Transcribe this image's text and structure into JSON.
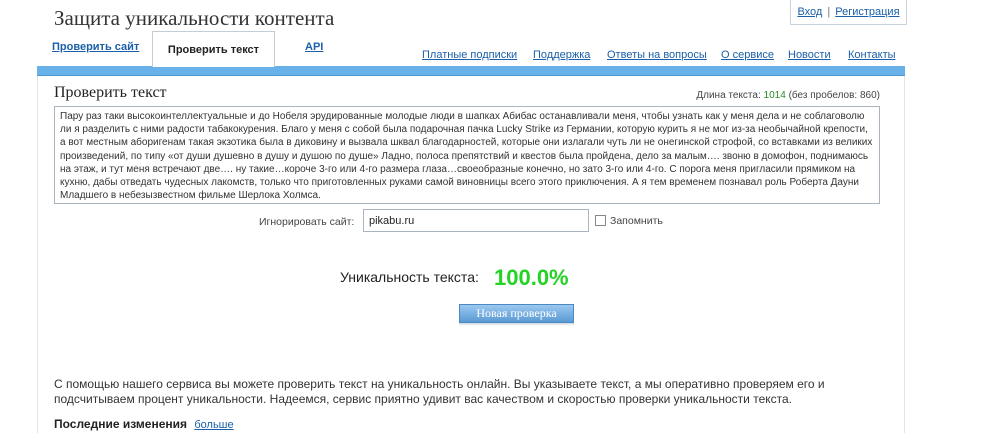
{
  "header": {
    "site_title": "Защита уникальности контента",
    "login": "Вход",
    "separator": "|",
    "register": "Регистрация"
  },
  "tabs": [
    {
      "label": "Проверить сайт"
    },
    {
      "label": "Проверить текст"
    },
    {
      "label": "API"
    }
  ],
  "topnav": [
    {
      "label": "Платные подписки"
    },
    {
      "label": "Поддержка"
    },
    {
      "label": "Ответы на вопросы"
    },
    {
      "label": "О сервисе"
    },
    {
      "label": "Новости"
    },
    {
      "label": "Контакты"
    }
  ],
  "check": {
    "title": "Проверить текст",
    "length_label": "Длина текста:",
    "length_value": "1014",
    "length_no_spaces": "(без пробелов: 860)",
    "text": "Пару раз таки высокоинтеллектуальные и до Нобеля эрудированные молодые люди в шапках Абибас останавливали меня, чтобы узнать как у меня дела и не соблаговолю ли я разделить с ними радости табакокурения. Благо у меня с собой была подарочная пачка Lucky Strike из Германии, которую курить я не мог из-за необычайной крепости, а вот местным аборигенам такая экзотика была в диковину и вызвала шквал благодарностей, которые они излагали чуть ли не онегинской строфой, со вставками из великих произведений, по типу «от души душевно в душу и душою по душе» Ладно, полоса препятствий и квестов была пройдена, дело за малым…. звоню в домофон, поднимаюсь на этаж, и тут меня встречают две…. ну такие…короче 3-го или 4-го размера глаза…своеобразные конечно, но зато 3-го или 4-го. С порога меня пригласили прямиком на кухню, дабы отведать чудесных лакомств, только что приготовленных руками самой виновницы всего этого приключения. А я тем временем познавал роль Роберта Дауни Младшего в небезызвестном фильме Шерлока Холмса.",
    "ignore_label": "Игнорировать сайт:",
    "ignore_value": "pikabu.ru",
    "remember_label": "Запомнить",
    "uniqueness_label": "Уникальность текста:",
    "uniqueness_value": "100.0%",
    "new_check_label": "Новая проверка"
  },
  "footer": {
    "description": "С помощью нашего сервиса вы можете проверить текст на уникальность онлайн. Вы указываете текст, а мы оперативно проверяем его и подсчитываем процент уникальности. Надеемся, сервис приятно удивит вас качеством и скоростью проверки уникальности текста.",
    "changes_label": "Последние изменения",
    "more_link": "больше"
  },
  "colors": {
    "accent_bar": "#69b2e9",
    "link": "#1a5fa8",
    "uniqueness": "#22d322"
  }
}
